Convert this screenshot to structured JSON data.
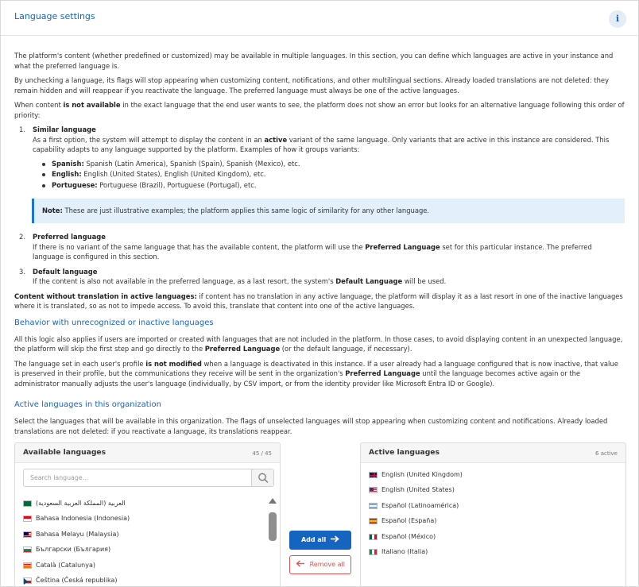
{
  "header": {
    "title": "Language settings",
    "info_label": "i"
  },
  "intro": {
    "p1": "The platform's content (whether predefined or customized) may be available in multiple languages. In this section, you can define which languages are active in your instance and what the preferred language is.",
    "p2": "By unchecking a language, its flags will stop appearing when customizing content, notifications, and other multilingual sections. Already loaded translations are not deleted: they remain hidden and will reappear if you reactivate the language. The preferred language must always be one of the active languages.",
    "p3_a": "When content ",
    "p3_b": "is not available",
    "p3_c": " in the exact language that the end user wants to see, the platform does not show an error but looks for an alternative language following this order of priority:"
  },
  "priority": [
    {
      "num": "1.",
      "title": "Similar language",
      "text_a": "As a first option, the system will attempt to display the content in an ",
      "text_b": "active",
      "text_c": " variant of the same language. Only variants that are active in this instance are considered. This capability adapts to any language supported by the platform. Examples of how it groups variants:",
      "examples": [
        {
          "label": "Spanish:",
          "value": " Spanish (Latin America), Spanish (Spain), Spanish (Mexico), etc."
        },
        {
          "label": "English:",
          "value": " English (United States), English (United Kingdom), etc."
        },
        {
          "label": "Portuguese:",
          "value": " Portuguese (Brazil), Portuguese (Portugal), etc."
        }
      ]
    },
    {
      "num": "2.",
      "title": "Preferred language",
      "text_a": "If there is no variant of the same language that has the available content, the platform will use the ",
      "text_b": "Preferred Language",
      "text_c": " set for this particular instance. The preferred language is configured in this section."
    },
    {
      "num": "3.",
      "title": "Default language",
      "text_a": "If the content is also not available in the preferred language, as a last resort, the system's ",
      "text_b": "Default Language",
      "text_c": " will be used."
    }
  ],
  "note": {
    "label": "Note:",
    "text": " These are just illustrative examples; the platform applies this same logic of similarity for any other language."
  },
  "no_translation": {
    "label": "Content without translation in active languages:",
    "text": " if content has no translation in any active language, the platform will display it as a last resort in one of the inactive languages where it is translated, so as not to impede access. To avoid this, translate that content into one of the active languages."
  },
  "behavior": {
    "title": "Behavior with unrecognized or inactive languages",
    "p1_a": "All this logic also applies if users are imported or created with languages that are not included in the platform. In those cases, to avoid displaying content in an unexpected language, the platform will skip the first step and go directly to the ",
    "p1_b": "Preferred Language",
    "p1_c": " (or the default language, if necessary).",
    "p2_a": "The language set in each user's profile ",
    "p2_b": "is not modified",
    "p2_c": " when a language is deactivated in this instance. If a user already had a language configured that is now inactive, that value is preserved in their profile, but the communications they receive will be sent in the organization's ",
    "p2_d": "Preferred Language",
    "p2_e": " until the language becomes active again or the administrator manually adjusts the user's language (individually, by CSV import, or from the identity provider like Microsoft Entra ID or Google)."
  },
  "active_section": {
    "title": "Active languages in this organization",
    "text": "Select the languages that will be available in this organization. The flags of unselected languages will stop appearing when customizing content and notifications. Already loaded translations are not deleted: if you reactivate a language, its translations reappear."
  },
  "available": {
    "title": "Available languages",
    "count": "45 / 45",
    "search_placeholder": "Search language...",
    "items": [
      {
        "label": "العربية (المملكة العربية السعودية)",
        "flag": "sa"
      },
      {
        "label": "Bahasa Indonesia (Indonesia)",
        "flag": "id"
      },
      {
        "label": "Bahasa Melayu (Malaysia)",
        "flag": "my"
      },
      {
        "label": "Български (България)",
        "flag": "bg"
      },
      {
        "label": "Català (Catalunya)",
        "flag": "cat"
      },
      {
        "label": "Čeština (Česká republika)",
        "flag": "cz"
      }
    ]
  },
  "active": {
    "title": "Active languages",
    "count": "6 active",
    "items": [
      {
        "label": "English (United Kingdom)",
        "flag": "gb"
      },
      {
        "label": "English (United States)",
        "flag": "us"
      },
      {
        "label": "Español (Latinoamérica)",
        "flag": "latam"
      },
      {
        "label": "Español (España)",
        "flag": "es"
      },
      {
        "label": "Español (México)",
        "flag": "mx"
      },
      {
        "label": "Italiano (Italia)",
        "flag": "it"
      }
    ]
  },
  "buttons": {
    "add_all": "Add all",
    "add_icon": "arrow-right-icon",
    "remove_all": "Remove all",
    "remove_icon": "arrow-left-icon"
  },
  "colors": {
    "accent": "#1565c0",
    "danger": "#d9534f",
    "note_bg": "#e3f0fc"
  }
}
